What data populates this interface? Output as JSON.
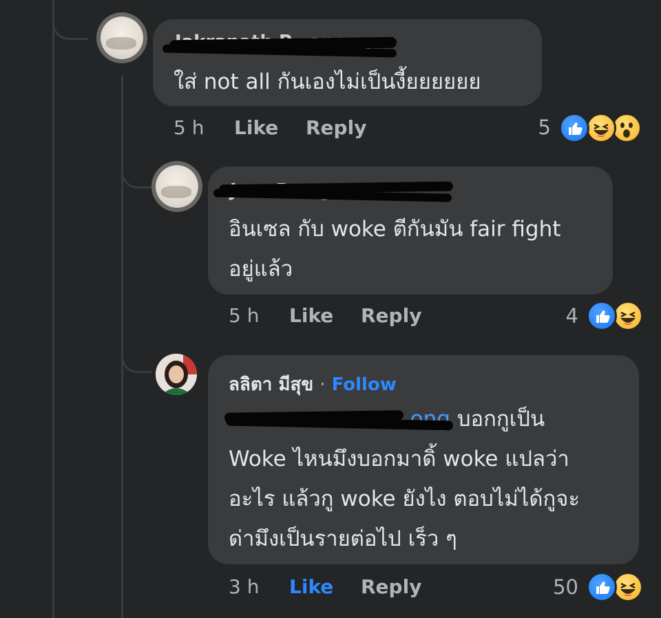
{
  "comments": [
    {
      "author": "Jakrapath P...apong",
      "author_redacted": true,
      "text_lines": [
        "ใส่ not all กันเองไม่เป็นงี้ยยยยยย"
      ],
      "time": "5 h",
      "like_label": "Like",
      "reply_label": "Reply",
      "reaction_count": "5",
      "reactions": [
        "like-icon",
        "haha-icon",
        "wow-icon"
      ]
    },
    {
      "author": "J...u P...ng",
      "author_redacted": true,
      "text_lines": [
        "อินเซล กับ woke ตีกันมัน fair fight",
        "อยู่แล้ว"
      ],
      "time": "5 h",
      "like_label": "Like",
      "reply_label": "Reply",
      "reaction_count": "4",
      "reactions": [
        "like-icon",
        "haha-icon"
      ]
    },
    {
      "author": "ลลิตา มีสุข",
      "separator": "·",
      "follow_label": "Follow",
      "mention_suffix": "ong",
      "text_lines": [
        " บอกกูเป็น",
        "Woke ไหนมึงบอกมาดิ้ woke แปลว่า",
        "อะไร แล้วกู woke ยังไง ตอบไม่ได้กูจะ",
        "ด่ามึงเป็นรายต่อไป เร็ว ๆ"
      ],
      "time": "3 h",
      "like_label": "Like",
      "reply_label": "Reply",
      "reaction_count": "50",
      "reactions": [
        "like-icon",
        "haha-icon"
      ],
      "like_active": true
    }
  ],
  "colors": {
    "background": "#242526",
    "bubble": "#3a3b3c",
    "text": "#e4e6eb",
    "meta": "#b0b3b8",
    "accent": "#2d88ff"
  }
}
